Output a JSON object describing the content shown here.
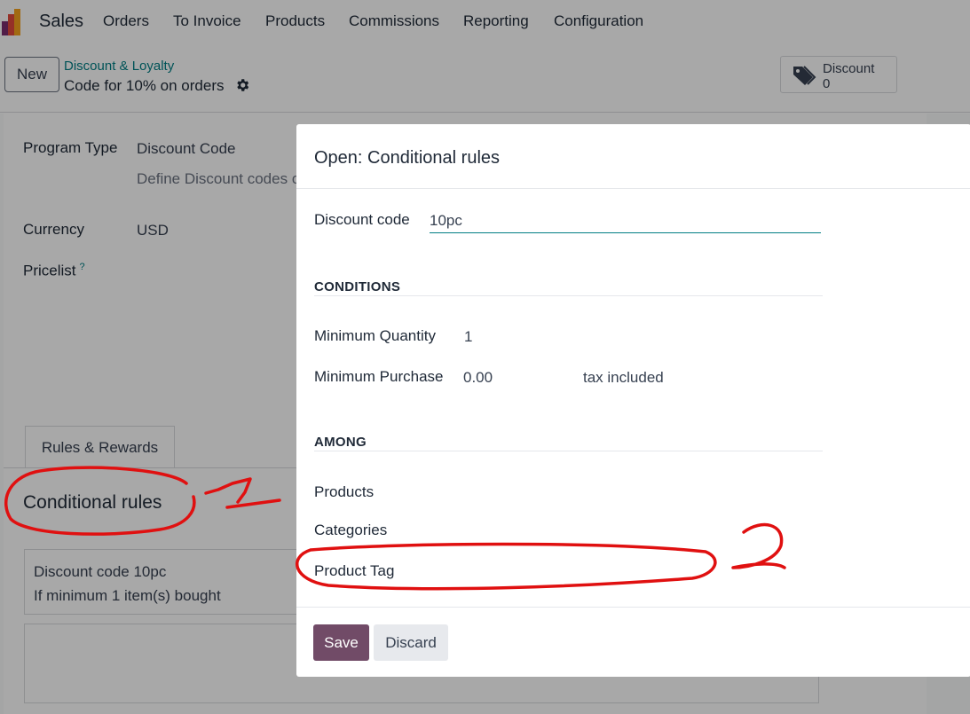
{
  "topnav": {
    "brand": "Sales",
    "menu": [
      "Orders",
      "To Invoice",
      "Products",
      "Commissions",
      "Reporting",
      "Configuration"
    ]
  },
  "control": {
    "new_label": "New",
    "breadcrumb_parent": "Discount & Loyalty",
    "breadcrumb_current": "Code for 10% on orders",
    "smart_button": {
      "label": "Discount",
      "value": "0"
    }
  },
  "form": {
    "program_type_label": "Program Type",
    "program_type_value": "Discount Code",
    "program_type_help": "Define Discount codes on conditional rules then share it with",
    "currency_label": "Currency",
    "currency_value": "USD",
    "pricelist_label": "Pricelist",
    "pricelist_tooltip": "?",
    "tab_label": "Rules & Rewards",
    "section_title": "Conditional rules",
    "rule_line1": "Discount code 10pc",
    "rule_line2": "If minimum 1 item(s) bought"
  },
  "modal": {
    "title": "Open: Conditional rules",
    "discount_code_label": "Discount code",
    "discount_code_value": "10pc",
    "conditions_title": "CONDITIONS",
    "min_qty_label": "Minimum Quantity",
    "min_qty_value": "1",
    "min_purchase_label": "Minimum Purchase",
    "min_purchase_value": "0.00",
    "tax_label": "tax included",
    "among_title": "AMONG",
    "products_label": "Products",
    "categories_label": "Categories",
    "product_tag_label": "Product Tag",
    "save_label": "Save",
    "discard_label": "Discard"
  },
  "colors": {
    "primary": "#714b67",
    "link": "#017e84",
    "annotation": "#e01010"
  }
}
